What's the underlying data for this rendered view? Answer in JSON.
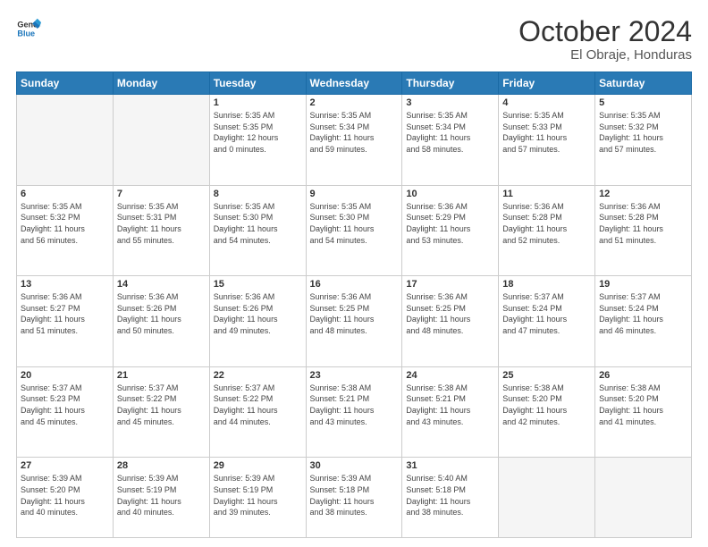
{
  "logo": {
    "line1": "General",
    "line2": "Blue"
  },
  "header": {
    "month": "October 2024",
    "location": "El Obraje, Honduras"
  },
  "days_of_week": [
    "Sunday",
    "Monday",
    "Tuesday",
    "Wednesday",
    "Thursday",
    "Friday",
    "Saturday"
  ],
  "weeks": [
    [
      {
        "day": "",
        "detail": ""
      },
      {
        "day": "",
        "detail": ""
      },
      {
        "day": "1",
        "detail": "Sunrise: 5:35 AM\nSunset: 5:35 PM\nDaylight: 12 hours\nand 0 minutes."
      },
      {
        "day": "2",
        "detail": "Sunrise: 5:35 AM\nSunset: 5:34 PM\nDaylight: 11 hours\nand 59 minutes."
      },
      {
        "day": "3",
        "detail": "Sunrise: 5:35 AM\nSunset: 5:34 PM\nDaylight: 11 hours\nand 58 minutes."
      },
      {
        "day": "4",
        "detail": "Sunrise: 5:35 AM\nSunset: 5:33 PM\nDaylight: 11 hours\nand 57 minutes."
      },
      {
        "day": "5",
        "detail": "Sunrise: 5:35 AM\nSunset: 5:32 PM\nDaylight: 11 hours\nand 57 minutes."
      }
    ],
    [
      {
        "day": "6",
        "detail": "Sunrise: 5:35 AM\nSunset: 5:32 PM\nDaylight: 11 hours\nand 56 minutes."
      },
      {
        "day": "7",
        "detail": "Sunrise: 5:35 AM\nSunset: 5:31 PM\nDaylight: 11 hours\nand 55 minutes."
      },
      {
        "day": "8",
        "detail": "Sunrise: 5:35 AM\nSunset: 5:30 PM\nDaylight: 11 hours\nand 54 minutes."
      },
      {
        "day": "9",
        "detail": "Sunrise: 5:35 AM\nSunset: 5:30 PM\nDaylight: 11 hours\nand 54 minutes."
      },
      {
        "day": "10",
        "detail": "Sunrise: 5:36 AM\nSunset: 5:29 PM\nDaylight: 11 hours\nand 53 minutes."
      },
      {
        "day": "11",
        "detail": "Sunrise: 5:36 AM\nSunset: 5:28 PM\nDaylight: 11 hours\nand 52 minutes."
      },
      {
        "day": "12",
        "detail": "Sunrise: 5:36 AM\nSunset: 5:28 PM\nDaylight: 11 hours\nand 51 minutes."
      }
    ],
    [
      {
        "day": "13",
        "detail": "Sunrise: 5:36 AM\nSunset: 5:27 PM\nDaylight: 11 hours\nand 51 minutes."
      },
      {
        "day": "14",
        "detail": "Sunrise: 5:36 AM\nSunset: 5:26 PM\nDaylight: 11 hours\nand 50 minutes."
      },
      {
        "day": "15",
        "detail": "Sunrise: 5:36 AM\nSunset: 5:26 PM\nDaylight: 11 hours\nand 49 minutes."
      },
      {
        "day": "16",
        "detail": "Sunrise: 5:36 AM\nSunset: 5:25 PM\nDaylight: 11 hours\nand 48 minutes."
      },
      {
        "day": "17",
        "detail": "Sunrise: 5:36 AM\nSunset: 5:25 PM\nDaylight: 11 hours\nand 48 minutes."
      },
      {
        "day": "18",
        "detail": "Sunrise: 5:37 AM\nSunset: 5:24 PM\nDaylight: 11 hours\nand 47 minutes."
      },
      {
        "day": "19",
        "detail": "Sunrise: 5:37 AM\nSunset: 5:24 PM\nDaylight: 11 hours\nand 46 minutes."
      }
    ],
    [
      {
        "day": "20",
        "detail": "Sunrise: 5:37 AM\nSunset: 5:23 PM\nDaylight: 11 hours\nand 45 minutes."
      },
      {
        "day": "21",
        "detail": "Sunrise: 5:37 AM\nSunset: 5:22 PM\nDaylight: 11 hours\nand 45 minutes."
      },
      {
        "day": "22",
        "detail": "Sunrise: 5:37 AM\nSunset: 5:22 PM\nDaylight: 11 hours\nand 44 minutes."
      },
      {
        "day": "23",
        "detail": "Sunrise: 5:38 AM\nSunset: 5:21 PM\nDaylight: 11 hours\nand 43 minutes."
      },
      {
        "day": "24",
        "detail": "Sunrise: 5:38 AM\nSunset: 5:21 PM\nDaylight: 11 hours\nand 43 minutes."
      },
      {
        "day": "25",
        "detail": "Sunrise: 5:38 AM\nSunset: 5:20 PM\nDaylight: 11 hours\nand 42 minutes."
      },
      {
        "day": "26",
        "detail": "Sunrise: 5:38 AM\nSunset: 5:20 PM\nDaylight: 11 hours\nand 41 minutes."
      }
    ],
    [
      {
        "day": "27",
        "detail": "Sunrise: 5:39 AM\nSunset: 5:20 PM\nDaylight: 11 hours\nand 40 minutes."
      },
      {
        "day": "28",
        "detail": "Sunrise: 5:39 AM\nSunset: 5:19 PM\nDaylight: 11 hours\nand 40 minutes."
      },
      {
        "day": "29",
        "detail": "Sunrise: 5:39 AM\nSunset: 5:19 PM\nDaylight: 11 hours\nand 39 minutes."
      },
      {
        "day": "30",
        "detail": "Sunrise: 5:39 AM\nSunset: 5:18 PM\nDaylight: 11 hours\nand 38 minutes."
      },
      {
        "day": "31",
        "detail": "Sunrise: 5:40 AM\nSunset: 5:18 PM\nDaylight: 11 hours\nand 38 minutes."
      },
      {
        "day": "",
        "detail": ""
      },
      {
        "day": "",
        "detail": ""
      }
    ]
  ]
}
